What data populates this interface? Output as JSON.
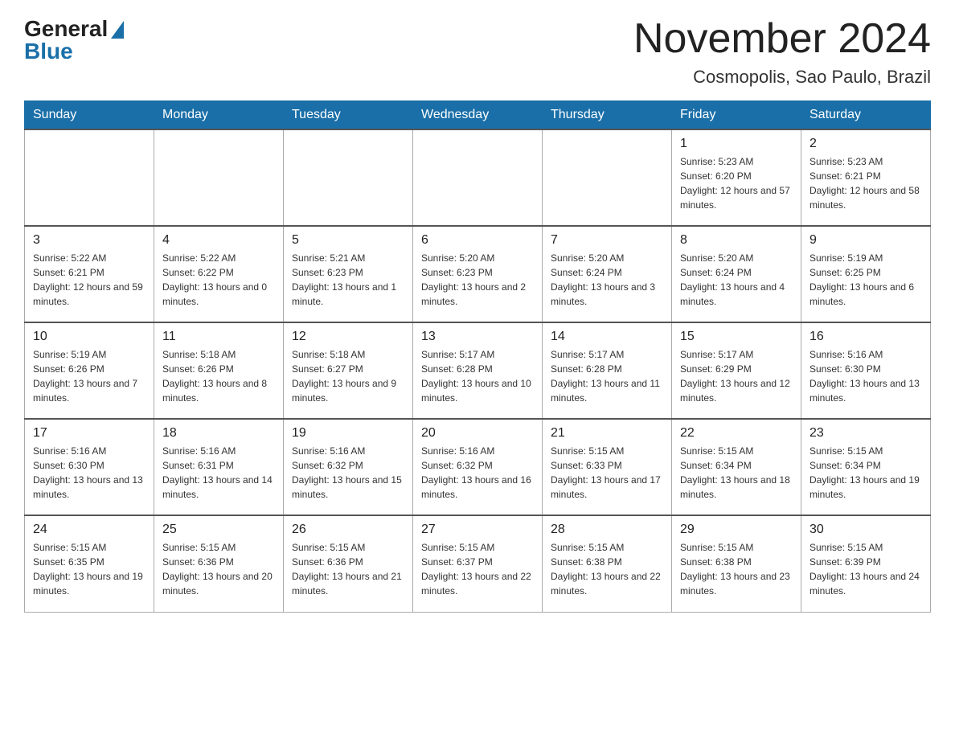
{
  "header": {
    "logo_general": "General",
    "logo_blue": "Blue",
    "month_title": "November 2024",
    "location": "Cosmopolis, Sao Paulo, Brazil"
  },
  "weekdays": [
    "Sunday",
    "Monday",
    "Tuesday",
    "Wednesday",
    "Thursday",
    "Friday",
    "Saturday"
  ],
  "weeks": [
    [
      {
        "day": "",
        "sunrise": "",
        "sunset": "",
        "daylight": ""
      },
      {
        "day": "",
        "sunrise": "",
        "sunset": "",
        "daylight": ""
      },
      {
        "day": "",
        "sunrise": "",
        "sunset": "",
        "daylight": ""
      },
      {
        "day": "",
        "sunrise": "",
        "sunset": "",
        "daylight": ""
      },
      {
        "day": "",
        "sunrise": "",
        "sunset": "",
        "daylight": ""
      },
      {
        "day": "1",
        "sunrise": "Sunrise: 5:23 AM",
        "sunset": "Sunset: 6:20 PM",
        "daylight": "Daylight: 12 hours and 57 minutes."
      },
      {
        "day": "2",
        "sunrise": "Sunrise: 5:23 AM",
        "sunset": "Sunset: 6:21 PM",
        "daylight": "Daylight: 12 hours and 58 minutes."
      }
    ],
    [
      {
        "day": "3",
        "sunrise": "Sunrise: 5:22 AM",
        "sunset": "Sunset: 6:21 PM",
        "daylight": "Daylight: 12 hours and 59 minutes."
      },
      {
        "day": "4",
        "sunrise": "Sunrise: 5:22 AM",
        "sunset": "Sunset: 6:22 PM",
        "daylight": "Daylight: 13 hours and 0 minutes."
      },
      {
        "day": "5",
        "sunrise": "Sunrise: 5:21 AM",
        "sunset": "Sunset: 6:23 PM",
        "daylight": "Daylight: 13 hours and 1 minute."
      },
      {
        "day": "6",
        "sunrise": "Sunrise: 5:20 AM",
        "sunset": "Sunset: 6:23 PM",
        "daylight": "Daylight: 13 hours and 2 minutes."
      },
      {
        "day": "7",
        "sunrise": "Sunrise: 5:20 AM",
        "sunset": "Sunset: 6:24 PM",
        "daylight": "Daylight: 13 hours and 3 minutes."
      },
      {
        "day": "8",
        "sunrise": "Sunrise: 5:20 AM",
        "sunset": "Sunset: 6:24 PM",
        "daylight": "Daylight: 13 hours and 4 minutes."
      },
      {
        "day": "9",
        "sunrise": "Sunrise: 5:19 AM",
        "sunset": "Sunset: 6:25 PM",
        "daylight": "Daylight: 13 hours and 6 minutes."
      }
    ],
    [
      {
        "day": "10",
        "sunrise": "Sunrise: 5:19 AM",
        "sunset": "Sunset: 6:26 PM",
        "daylight": "Daylight: 13 hours and 7 minutes."
      },
      {
        "day": "11",
        "sunrise": "Sunrise: 5:18 AM",
        "sunset": "Sunset: 6:26 PM",
        "daylight": "Daylight: 13 hours and 8 minutes."
      },
      {
        "day": "12",
        "sunrise": "Sunrise: 5:18 AM",
        "sunset": "Sunset: 6:27 PM",
        "daylight": "Daylight: 13 hours and 9 minutes."
      },
      {
        "day": "13",
        "sunrise": "Sunrise: 5:17 AM",
        "sunset": "Sunset: 6:28 PM",
        "daylight": "Daylight: 13 hours and 10 minutes."
      },
      {
        "day": "14",
        "sunrise": "Sunrise: 5:17 AM",
        "sunset": "Sunset: 6:28 PM",
        "daylight": "Daylight: 13 hours and 11 minutes."
      },
      {
        "day": "15",
        "sunrise": "Sunrise: 5:17 AM",
        "sunset": "Sunset: 6:29 PM",
        "daylight": "Daylight: 13 hours and 12 minutes."
      },
      {
        "day": "16",
        "sunrise": "Sunrise: 5:16 AM",
        "sunset": "Sunset: 6:30 PM",
        "daylight": "Daylight: 13 hours and 13 minutes."
      }
    ],
    [
      {
        "day": "17",
        "sunrise": "Sunrise: 5:16 AM",
        "sunset": "Sunset: 6:30 PM",
        "daylight": "Daylight: 13 hours and 13 minutes."
      },
      {
        "day": "18",
        "sunrise": "Sunrise: 5:16 AM",
        "sunset": "Sunset: 6:31 PM",
        "daylight": "Daylight: 13 hours and 14 minutes."
      },
      {
        "day": "19",
        "sunrise": "Sunrise: 5:16 AM",
        "sunset": "Sunset: 6:32 PM",
        "daylight": "Daylight: 13 hours and 15 minutes."
      },
      {
        "day": "20",
        "sunrise": "Sunrise: 5:16 AM",
        "sunset": "Sunset: 6:32 PM",
        "daylight": "Daylight: 13 hours and 16 minutes."
      },
      {
        "day": "21",
        "sunrise": "Sunrise: 5:15 AM",
        "sunset": "Sunset: 6:33 PM",
        "daylight": "Daylight: 13 hours and 17 minutes."
      },
      {
        "day": "22",
        "sunrise": "Sunrise: 5:15 AM",
        "sunset": "Sunset: 6:34 PM",
        "daylight": "Daylight: 13 hours and 18 minutes."
      },
      {
        "day": "23",
        "sunrise": "Sunrise: 5:15 AM",
        "sunset": "Sunset: 6:34 PM",
        "daylight": "Daylight: 13 hours and 19 minutes."
      }
    ],
    [
      {
        "day": "24",
        "sunrise": "Sunrise: 5:15 AM",
        "sunset": "Sunset: 6:35 PM",
        "daylight": "Daylight: 13 hours and 19 minutes."
      },
      {
        "day": "25",
        "sunrise": "Sunrise: 5:15 AM",
        "sunset": "Sunset: 6:36 PM",
        "daylight": "Daylight: 13 hours and 20 minutes."
      },
      {
        "day": "26",
        "sunrise": "Sunrise: 5:15 AM",
        "sunset": "Sunset: 6:36 PM",
        "daylight": "Daylight: 13 hours and 21 minutes."
      },
      {
        "day": "27",
        "sunrise": "Sunrise: 5:15 AM",
        "sunset": "Sunset: 6:37 PM",
        "daylight": "Daylight: 13 hours and 22 minutes."
      },
      {
        "day": "28",
        "sunrise": "Sunrise: 5:15 AM",
        "sunset": "Sunset: 6:38 PM",
        "daylight": "Daylight: 13 hours and 22 minutes."
      },
      {
        "day": "29",
        "sunrise": "Sunrise: 5:15 AM",
        "sunset": "Sunset: 6:38 PM",
        "daylight": "Daylight: 13 hours and 23 minutes."
      },
      {
        "day": "30",
        "sunrise": "Sunrise: 5:15 AM",
        "sunset": "Sunset: 6:39 PM",
        "daylight": "Daylight: 13 hours and 24 minutes."
      }
    ]
  ]
}
